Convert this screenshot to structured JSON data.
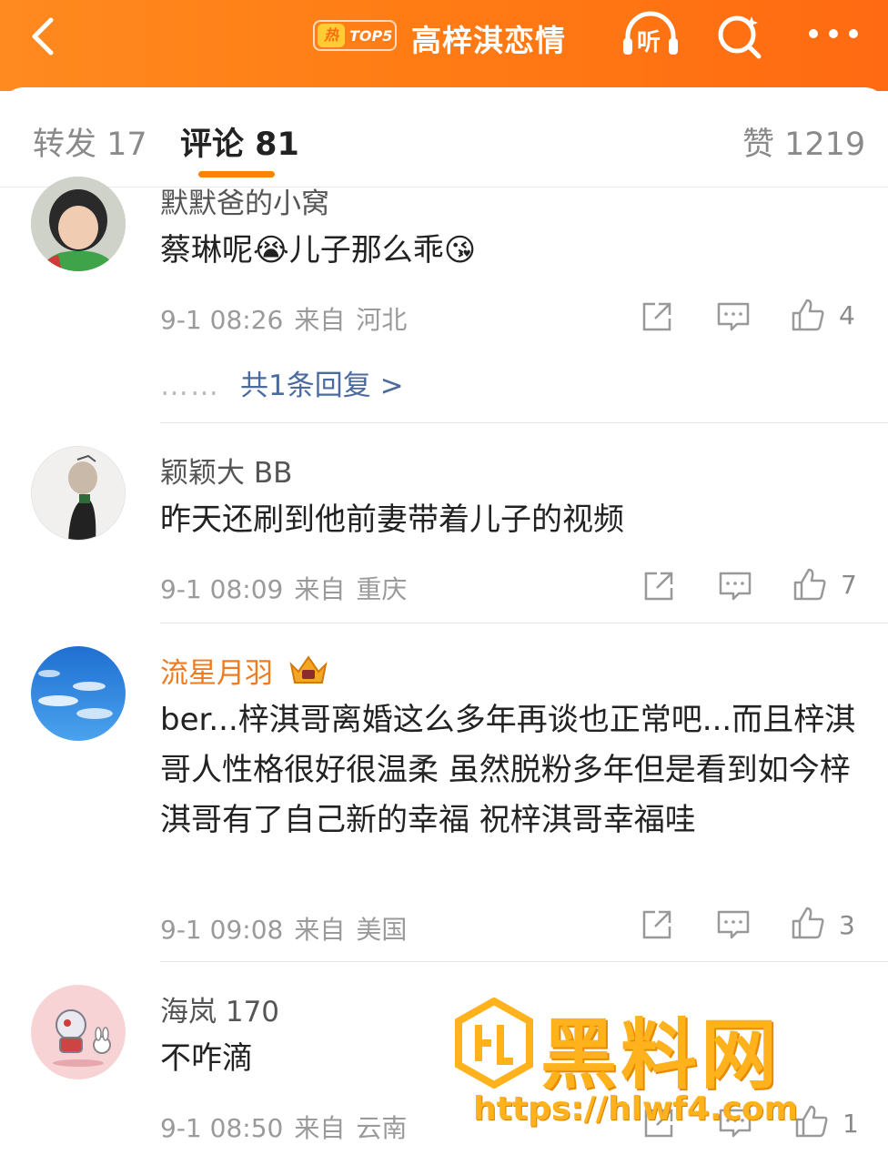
{
  "header": {
    "hot_badge_char": "热",
    "hot_badge_rank": "TOP5",
    "title": "高梓淇恋情",
    "listen_label": "听"
  },
  "tabs": {
    "repost": "转发 17",
    "comments": "评论 81",
    "likes": "赞 1219"
  },
  "comments": [
    {
      "user": "默默爸的小窝",
      "text": "蔡琳呢😭儿子那么乖😘",
      "time": "9-1 08:26",
      "from": "来自",
      "location": "河北",
      "likes": "4",
      "replies": "共1条回复 >",
      "replies_dots": "……"
    },
    {
      "user": "颖颖大 BB",
      "text": "昨天还刷到他前妻带着儿子的视频",
      "time": "9-1 08:09",
      "from": "来自",
      "location": "重庆",
      "likes": "7"
    },
    {
      "user": "流星月羽",
      "text": "ber...梓淇哥离婚这么多年再谈也正常吧...而且梓淇哥人性格很好很温柔 虽然脱粉多年但是看到如今梓淇哥有了自己新的幸福 祝梓淇哥幸福哇",
      "time": "9-1 09:08",
      "from": "来自",
      "location": "美国",
      "likes": "3"
    },
    {
      "user": "海岚 170",
      "text": "不咋滴",
      "time": "9-1 08:50",
      "from": "来自",
      "location": "云南",
      "likes": "1"
    }
  ],
  "watermark": {
    "text": "黑料网",
    "url": "https://hlwf4.com"
  },
  "colors": {
    "header_orange": "#ff7b14",
    "tab_underline": "#ff8200",
    "vip_name": "#ef7a20",
    "reply_link": "#4a6aa0"
  }
}
